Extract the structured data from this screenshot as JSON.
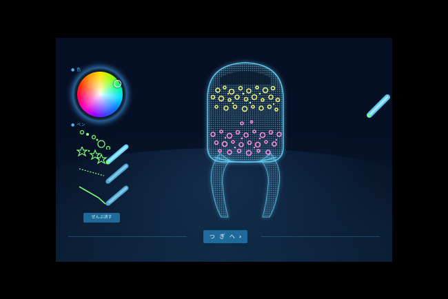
{
  "left_panel": {
    "color_label": "● 色",
    "pen_label": "● ペン"
  },
  "pen_options": [
    {
      "name": "dots-pen",
      "color": "#7cff7c"
    },
    {
      "name": "stars-pen",
      "color": "#7cff7c"
    },
    {
      "name": "dash-pen",
      "color": "#7cff7c"
    },
    {
      "name": "line-pen",
      "color": "#7cff7c"
    }
  ],
  "buttons": {
    "clear_all": "ぜんぶ消す",
    "next": "つ ぎ へ",
    "next_chevron": "›"
  },
  "colors": {
    "accent_button": "#1e6a9a",
    "selected_pen_color": "#7cff7c",
    "stripe_yellow": "#ecf27a",
    "stripe_pink": "#ff8ce0",
    "figure_outline": "#5ec8f0"
  }
}
